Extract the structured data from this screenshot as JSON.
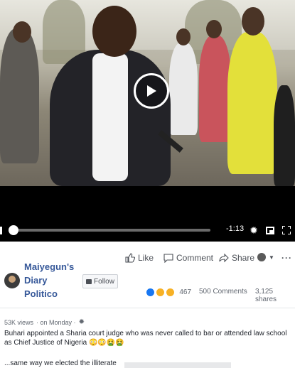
{
  "player": {
    "time_remaining": "-1:13",
    "progress_fraction": 0.02
  },
  "actions": {
    "like": "Like",
    "comment": "Comment",
    "share": "Share"
  },
  "page": {
    "name_line1": "Maiyegun's",
    "name_line2": "Diary",
    "name_line3": "Politico",
    "follow_label": "Follow"
  },
  "stats": {
    "reactions": "467",
    "comments": "500 Comments",
    "shares": "3,125 shares"
  },
  "post": {
    "views": "53K views",
    "when": "· on Monday ·",
    "text": "Buhari appointed a Sharia court judge who was never called to bar or attended law school as Chief Justice of Nigeria 😳😳🤮🤮",
    "truncated_line": "...same way we elected the illiterate"
  },
  "colors": {
    "link_blue": "#365899",
    "like_blue": "#1877f2",
    "emoji_yellow": "#f7b125"
  }
}
